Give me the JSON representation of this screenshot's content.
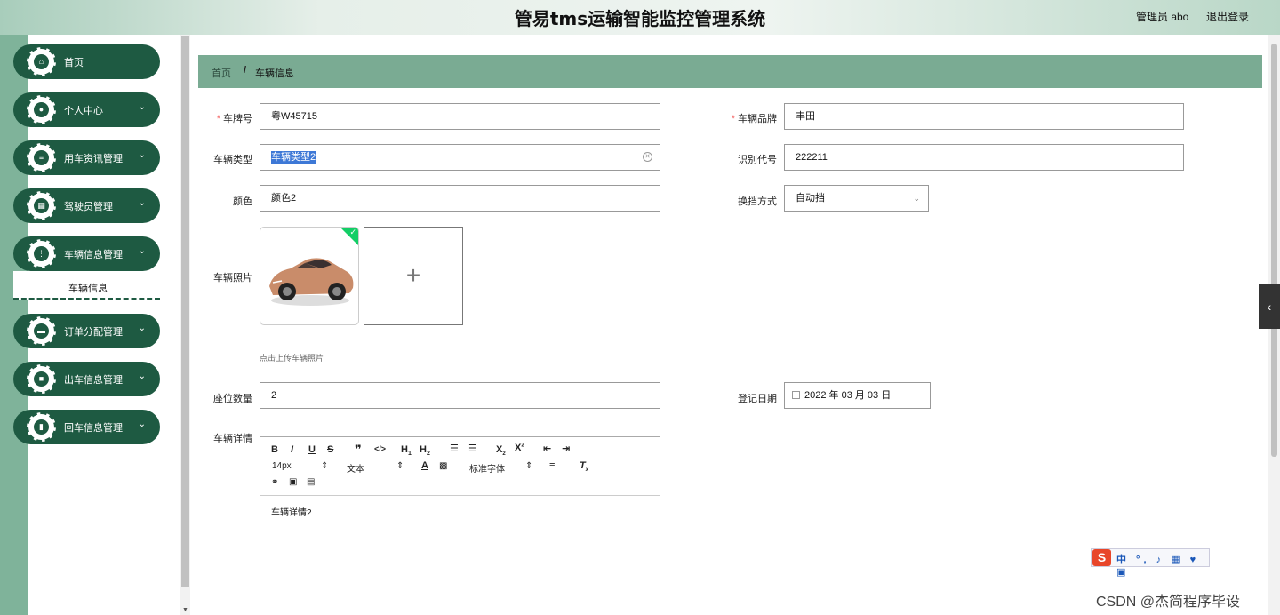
{
  "header": {
    "title": "管易tms运输智能监控管理系统",
    "user": "管理员 abo",
    "logout": "退出登录"
  },
  "sidebar": {
    "items": [
      {
        "label": "首页",
        "icon": "home-icon",
        "glyph": "⌂",
        "chevron": ""
      },
      {
        "label": "个人中心",
        "icon": "user-icon",
        "glyph": "●",
        "chevron": "⌄"
      },
      {
        "label": "用车资讯管理",
        "icon": "sliders-icon",
        "glyph": "≡",
        "chevron": "⌄"
      },
      {
        "label": "驾驶员管理",
        "icon": "grid-icon",
        "glyph": "▦",
        "chevron": "⌄"
      },
      {
        "label": "车辆信息管理",
        "icon": "apps-icon",
        "glyph": "⋮",
        "chevron": "⌄"
      },
      {
        "label": "订单分配管理",
        "icon": "chart-icon",
        "glyph": "▬",
        "chevron": "⌄"
      },
      {
        "label": "出车信息管理",
        "icon": "camera-icon",
        "glyph": "■",
        "chevron": "⌄"
      },
      {
        "label": "回车信息管理",
        "icon": "clipboard-icon",
        "glyph": "▮",
        "chevron": "⌄"
      }
    ],
    "submenu": "车辆信息"
  },
  "breadcrumb": {
    "home": "首页",
    "separator": "/",
    "current": "车辆信息"
  },
  "form": {
    "plate_label": "车牌号",
    "plate_value": "粤W45715",
    "brand_label": "车辆品牌",
    "brand_value": "丰田",
    "type_label": "车辆类型",
    "type_value": "车辆类型2",
    "vin_label": "识别代号",
    "vin_value": "222211",
    "color_label": "颜色",
    "color_value": "颜色2",
    "gear_label": "换挡方式",
    "gear_value": "自动挡",
    "photo_label": "车辆照片",
    "photo_hint": "点击上传车辆照片",
    "upload_plus": "+",
    "seats_label": "座位数量",
    "seats_value": "2",
    "date_label": "登记日期",
    "date_value": "2022 年 03 月 03 日",
    "details_label": "车辆详情",
    "details_value": "车辆详情2",
    "required_mark": "*"
  },
  "editor": {
    "font_size": "14px",
    "text_type": "文本",
    "font_family": "标准字体"
  },
  "ime": {
    "logo": "S",
    "tools": "中 °, ♪ ▦ ♥ ▣"
  },
  "watermark": "CSDN @杰简程序毕设",
  "colors": {
    "sidebar_green": "#1e5a42",
    "breadcrumb_green": "#7aab93",
    "selection_blue": "#3d78d6"
  }
}
